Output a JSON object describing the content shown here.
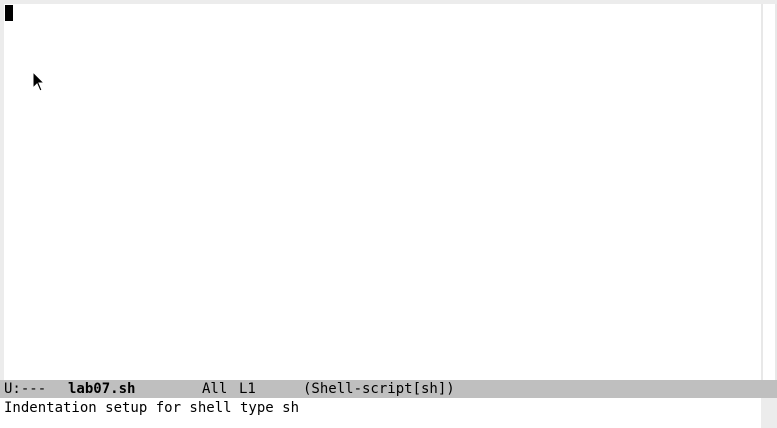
{
  "window": {
    "buffer_filename": "lab07.sh",
    "point_line": 1,
    "point_column": 0
  },
  "mode_line": {
    "status": "U:---",
    "buffer_name": "lab07.sh",
    "position": "All",
    "line": "L1",
    "modes": "(Shell-script[sh])"
  },
  "echo_area": {
    "message": "Indentation setup for shell type sh"
  },
  "icons": {
    "mouse_pointer": "arrow-pointer-icon",
    "text_cursor": "block-cursor-icon"
  },
  "colors": {
    "buffer_background": "#ffffff",
    "mode_line_background": "#bfbfbf",
    "frame_background": "#ececec",
    "cursor": "#000000"
  }
}
